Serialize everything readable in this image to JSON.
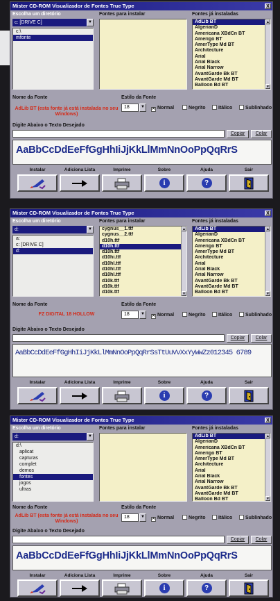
{
  "colors": {
    "titlebar": "#1a1a7e",
    "window_bg": "#a4a1b0",
    "font_name_red": "#d42a18",
    "sample_blue": "#1b2a8a",
    "selection": "#1a1a7e"
  },
  "window": {
    "title": "Mister CD-ROM Visualizador de Fontes True Type",
    "close_label": "X"
  },
  "labels": {
    "choose_dir": "Escolha um diretório",
    "fonts_to_install": "Fontes para instalar",
    "installed_fonts": "Fontes já instaladas",
    "font_name": "Nome da Fonte",
    "font_style": "Estilo da Fonte",
    "type_text": "Digite Abaixo o Texto Desejado",
    "copy": "Copiar",
    "paste": "Colar"
  },
  "styles": {
    "normal": "Normal",
    "bold": "Negrito",
    "italic": "Itálico",
    "underline": "Sublinhado"
  },
  "buttons": {
    "install": "Instalar",
    "add_list": "Adiciona Lista",
    "print": "Imprime",
    "about": "Sobre",
    "help": "Ajuda",
    "exit": "Sair"
  },
  "icons": [
    "pen-install-icon",
    "arrow-right-icon",
    "printer-icon",
    "info-icon",
    "help-icon",
    "exit-door-icon"
  ],
  "installed_fonts": [
    "AdLib BT",
    "AlgerianD",
    "Americana XBdCn BT",
    "Amerigo BT",
    "AmerType Md BT",
    "Architecture",
    "Arial",
    "Arial Black",
    "Arial Narrow",
    "AvantGarde Bk BT",
    "AvantGarde Md BT",
    "Balloon Bd BT"
  ],
  "screens": [
    {
      "drive": "c: [DRIVE C]",
      "dirs": [
        "c:\\",
        "mfonte"
      ],
      "selected_dir": "mfonte",
      "fonts_to_install": [],
      "font_name": "AdLib BT (esta fonte já está instalada no seu Windows)",
      "size": "18",
      "sample": "AaBbCcDdEeFfGgHhIiJjKkLlMmNnOoPpQqRrS"
    },
    {
      "drive": "c: [DRIVE C]",
      "dirs": [
        "d:",
        "a:",
        "c: [DRIVE C]",
        "d:"
      ],
      "selected_dir": "d:",
      "fonts_to_install": [
        "cygnus__1.ttf",
        "cygnus__2.ttf",
        "d10h.ttf",
        "d10h.ttf",
        "d10h.ttf",
        "d10hi.ttf",
        "d10hl.ttf",
        "d10hl.ttf",
        "d10hl.ttf",
        "d10k.ttf",
        "d10k.ttf",
        "d10k.ttf",
        "d10k.ttf"
      ],
      "font_name": "FZ DIGITAL 18 HOLLOW",
      "size": "18",
      "sample": "AaBbCcDdEeFfGgHhIiJjKkLlMmNnOoPpQqRrSsTtUuVvXxYyWwZz012345 6789"
    },
    {
      "drive": "d:",
      "dirs": [
        "d:\\",
        "aplicat",
        "capturas",
        "complet",
        "demos",
        "fontes",
        "jogos",
        "ultras"
      ],
      "selected_dir": "fontes",
      "fonts_to_install": [],
      "font_name": "AdLib BT (esta fonte já está instalada no seu Windows)",
      "size": "18",
      "sample": "AaBbCcDdEeFfGgHhIiJjKkLlMmNnOoPpQqRrS"
    }
  ]
}
